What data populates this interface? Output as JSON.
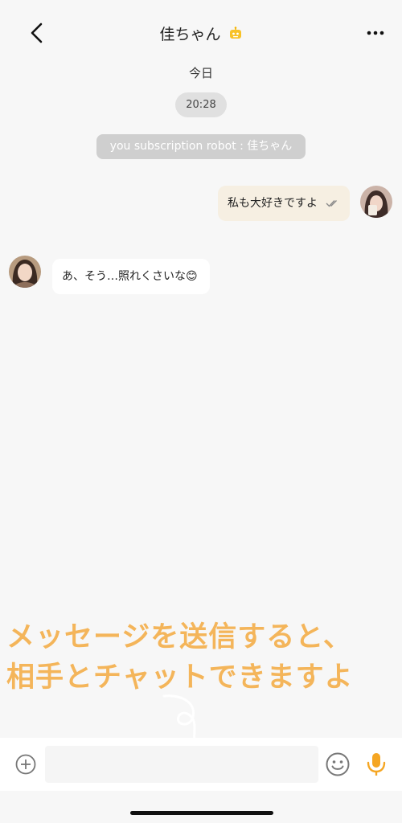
{
  "header": {
    "title": "佳ちゃん",
    "back_icon": "chevron-left-icon",
    "robot_icon": "robot-icon",
    "more_icon": "ellipsis-icon"
  },
  "chat": {
    "day_label": "今日",
    "time": "20:28",
    "system_message": "you subscription robot : 佳ちゃん",
    "messages": [
      {
        "side": "right",
        "text": "私も大好きですよ",
        "status_icon": "double-check-icon"
      },
      {
        "side": "left",
        "text": "あ、そう…照れくさいな😊"
      }
    ]
  },
  "promo": {
    "line1": "メッセージを送信すると、",
    "line2": "相手とチャットできますよ",
    "color": "#f4b55a"
  },
  "input_bar": {
    "placeholder": "",
    "plus_icon": "add-circle-icon",
    "emoji_icon": "emoji-icon",
    "mic_icon": "microphone-icon",
    "mic_color": "#f5a623"
  }
}
